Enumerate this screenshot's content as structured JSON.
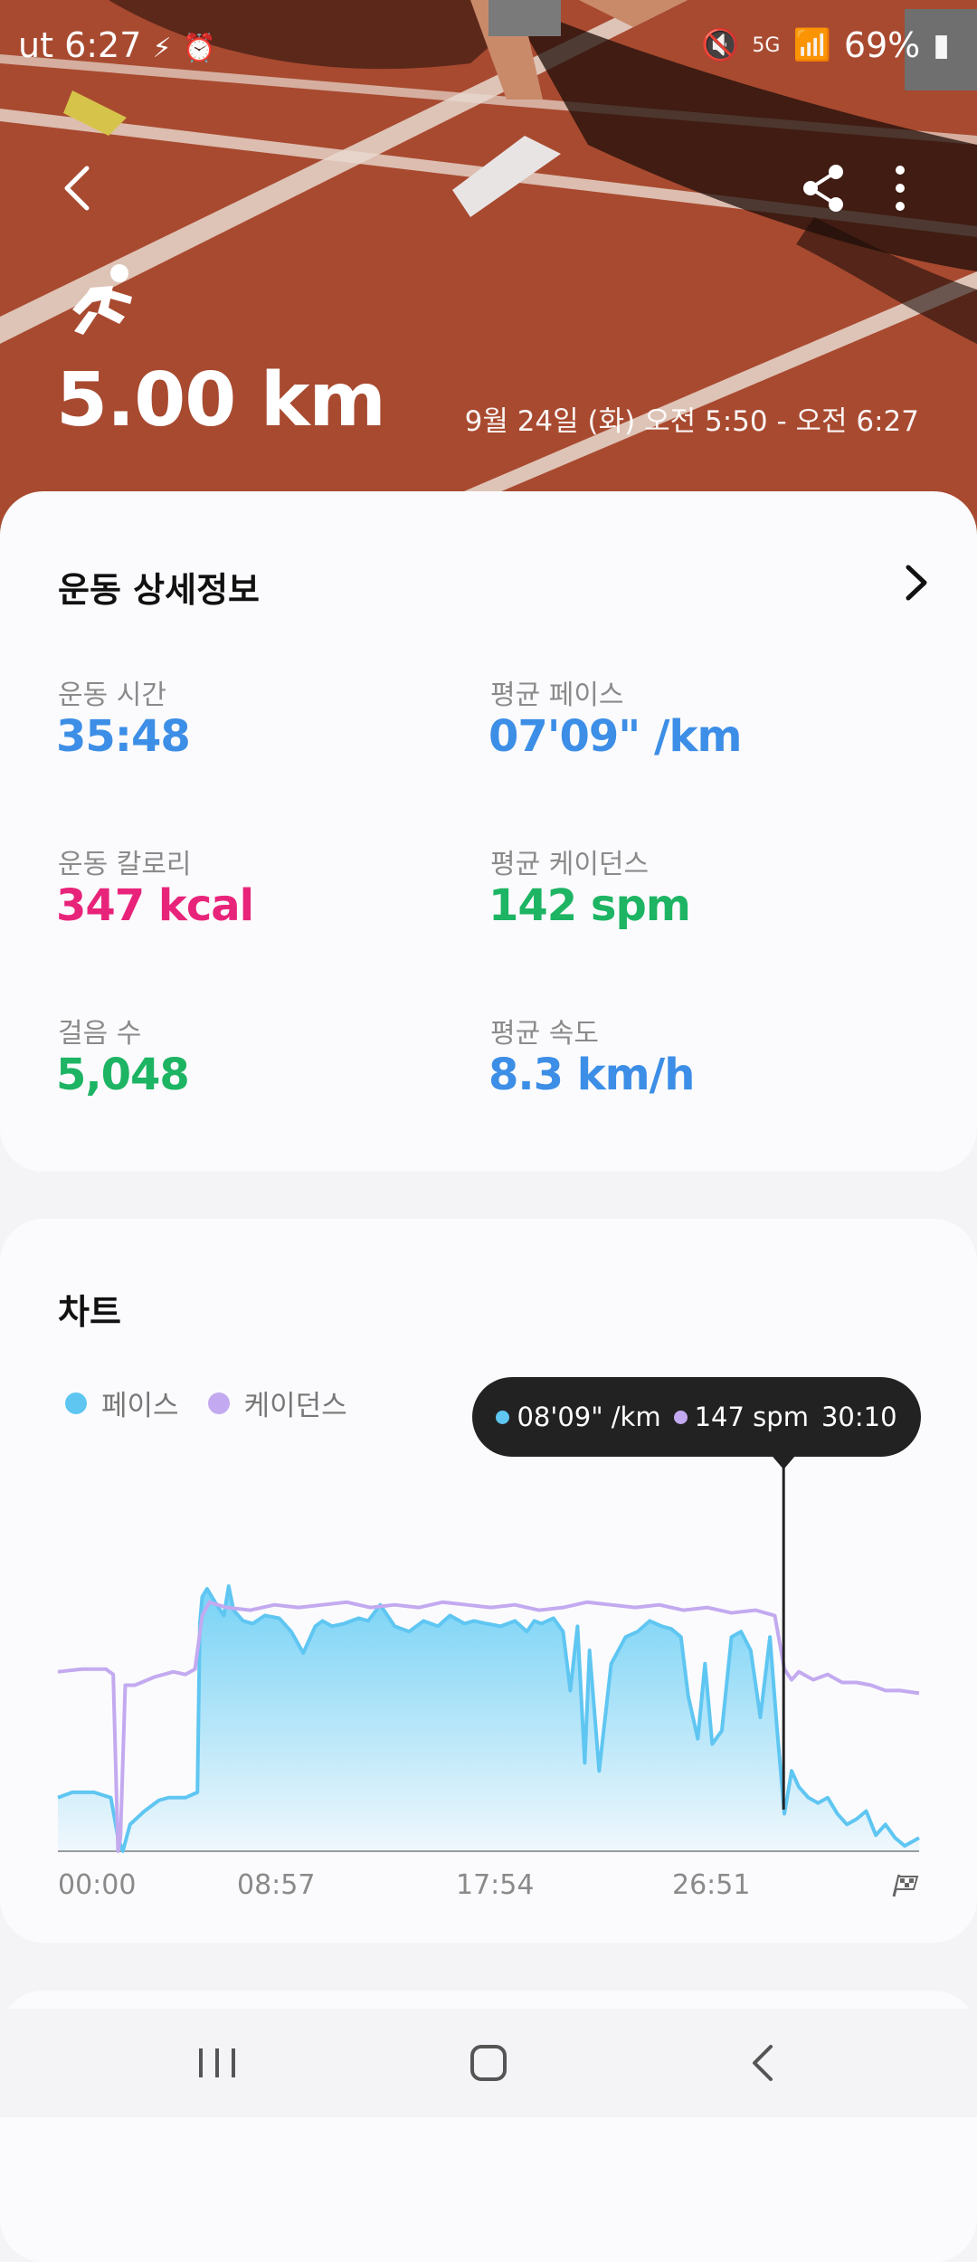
{
  "status_bar": {
    "time": "6:27",
    "carrier_prefix": "ut",
    "battery": "69%",
    "network": "5G"
  },
  "hero": {
    "distance": "5.00 km",
    "time_range": "9월 24일 (화) 오전 5:50 - 오전 6:27",
    "icons": [
      "back-icon",
      "share-icon",
      "more-icon",
      "running-icon"
    ]
  },
  "details": {
    "title": "운동 상세정보",
    "stats": [
      {
        "label": "운동 시간",
        "value": "35:48",
        "color": "#3d8ee6"
      },
      {
        "label": "평균 페이스",
        "value": "07'09\" /km",
        "color": "#3d8ee6"
      },
      {
        "label": "운동 칼로리",
        "value": "347 kcal",
        "color": "#e8247a"
      },
      {
        "label": "평균 케이던스",
        "value": "142 spm",
        "color": "#1db463"
      },
      {
        "label": "걸음 수",
        "value": "5,048",
        "color": "#1db463"
      },
      {
        "label": "평균 속도",
        "value": "8.3 km/h",
        "color": "#3d8ee6"
      }
    ]
  },
  "chart_section": {
    "title": "차트",
    "legend": [
      {
        "name": "페이스",
        "color": "#5fc6f2"
      },
      {
        "name": "케이던스",
        "color": "#c3aaf0"
      }
    ],
    "tooltip": {
      "pace": "08'09\" /km",
      "cadence": "147 spm",
      "time": "30:10"
    }
  },
  "chart_data": {
    "type": "area",
    "x_tick_labels": [
      "00:00",
      "08:57",
      "17:54",
      "26:51"
    ],
    "x_unit": "minutes",
    "xlim": [
      0,
      35.8
    ],
    "series": [
      {
        "name": "페이스",
        "color": "#5fc6f2",
        "x": [
          0,
          0.6,
          1.5,
          2.2,
          2.5,
          2.7,
          3.0,
          3.6,
          4.2,
          4.6,
          5.3,
          5.8,
          5.9,
          6.0,
          6.2,
          6.6,
          6.9,
          7.1,
          7.3,
          7.7,
          8.1,
          8.6,
          9.2,
          9.7,
          10.2,
          10.7,
          11.0,
          11.4,
          11.9,
          12.5,
          12.9,
          13.4,
          14.0,
          14.6,
          15.2,
          15.8,
          16.3,
          16.9,
          17.3,
          17.8,
          18.4,
          19.0,
          19.5,
          19.8,
          20.1,
          20.6,
          21.0,
          21.3,
          21.6,
          21.9,
          22.1,
          22.5,
          23.0,
          23.6,
          24.1,
          24.6,
          25.1,
          25.5,
          25.9,
          26.2,
          26.6,
          26.9,
          27.2,
          27.6,
          28.0,
          28.4,
          28.8,
          29.2,
          29.6,
          29.9,
          30.2,
          30.5,
          30.8,
          31.2,
          31.6,
          32.0,
          32.4,
          32.8,
          33.2,
          33.6,
          34.0,
          34.4,
          34.8,
          35.2,
          35.8
        ],
        "y": [
          0.2,
          0.22,
          0.22,
          0.2,
          0.05,
          0.0,
          0.1,
          0.15,
          0.19,
          0.2,
          0.2,
          0.22,
          0.85,
          0.95,
          0.98,
          0.92,
          0.88,
          0.99,
          0.9,
          0.86,
          0.85,
          0.88,
          0.87,
          0.82,
          0.74,
          0.84,
          0.86,
          0.84,
          0.85,
          0.87,
          0.86,
          0.92,
          0.84,
          0.82,
          0.86,
          0.84,
          0.88,
          0.85,
          0.86,
          0.85,
          0.84,
          0.86,
          0.82,
          0.86,
          0.85,
          0.87,
          0.82,
          0.6,
          0.84,
          0.33,
          0.75,
          0.3,
          0.7,
          0.8,
          0.82,
          0.86,
          0.84,
          0.83,
          0.8,
          0.58,
          0.42,
          0.7,
          0.4,
          0.45,
          0.8,
          0.82,
          0.75,
          0.5,
          0.8,
          0.45,
          0.14,
          0.3,
          0.24,
          0.2,
          0.18,
          0.2,
          0.14,
          0.1,
          0.12,
          0.15,
          0.06,
          0.1,
          0.05,
          0.02,
          0.05
        ]
      },
      {
        "name": "케이던스",
        "color": "#c3aaf0",
        "x": [
          0,
          1.0,
          2.0,
          2.3,
          2.5,
          2.6,
          2.8,
          3.2,
          4.0,
          4.8,
          5.3,
          5.7,
          6.0,
          6.3,
          7.0,
          8.0,
          9.0,
          10.0,
          11.0,
          12.0,
          13.0,
          14.0,
          15.0,
          16.0,
          17.0,
          18.0,
          19.0,
          20.0,
          21.0,
          22.0,
          23.0,
          24.0,
          25.0,
          26.0,
          27.0,
          28.0,
          29.0,
          29.8,
          30.2,
          30.5,
          30.8,
          31.4,
          32.0,
          32.6,
          33.2,
          33.8,
          34.4,
          35.0,
          35.8
        ],
        "y": [
          0.67,
          0.68,
          0.68,
          0.66,
          0.0,
          0.05,
          0.62,
          0.62,
          0.65,
          0.67,
          0.66,
          0.68,
          0.88,
          0.93,
          0.91,
          0.9,
          0.92,
          0.91,
          0.92,
          0.93,
          0.91,
          0.92,
          0.91,
          0.93,
          0.92,
          0.91,
          0.92,
          0.9,
          0.91,
          0.93,
          0.92,
          0.91,
          0.92,
          0.9,
          0.91,
          0.89,
          0.9,
          0.88,
          0.68,
          0.64,
          0.67,
          0.64,
          0.66,
          0.63,
          0.63,
          0.62,
          0.6,
          0.6,
          0.59
        ]
      }
    ]
  },
  "navbar": {
    "icons": [
      "recents-icon",
      "home-icon",
      "back-nav-icon"
    ]
  }
}
